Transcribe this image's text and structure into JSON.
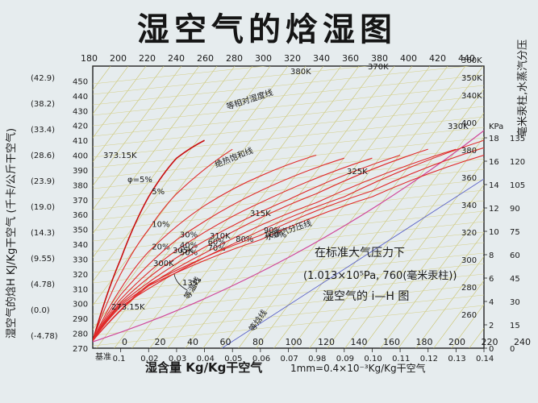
{
  "title": "湿空气的焓湿图",
  "axes": {
    "xlabel": "湿含量 Kg/Kg干空气",
    "scale_note": "1mm=0.4×10⁻³Kg/Kg干空气",
    "ylabel_left": "湿空气的焓H KJ/Kg干空气 (千卡/公斤干空气)",
    "ylabel_right": "毫米汞柱,水蒸汽分压",
    "kpa_unit": "KPa",
    "origin_label": "基准"
  },
  "annotations": {
    "phi_series_label": "φ=5%",
    "const_rh_label": "等相对湿度线",
    "adiabatic_label": "绝热饱和线",
    "isenthalpic_label": "等焓线",
    "partial_pressure_label": "水蒸汽分压线",
    "const_temp_label": "等温线",
    "angle_label": "135°",
    "notes": [
      "在标准大气压力下",
      "(1.013×10⁵Pa, 760(毫米汞柱))",
      "湿空气的 i—H 图"
    ]
  },
  "chart_data": {
    "type": "line",
    "title": "湿空气的焓湿图",
    "xlabel": "湿含量 Kg/Kg干空气",
    "ylabel": "湿空气的焓H KJ/Kg干空气",
    "xlim": [
      0,
      0.14
    ],
    "ylim": [
      270,
      460
    ],
    "x_ticks": [
      {
        "value": 0.01,
        "label": "0.1"
      },
      {
        "value": 0.02,
        "label": "0.02"
      },
      {
        "value": 0.03,
        "label": "0.03"
      },
      {
        "value": 0.04,
        "label": "0.04"
      },
      {
        "value": 0.05,
        "label": "0.05"
      },
      {
        "value": 0.06,
        "label": "0.06"
      },
      {
        "value": 0.07,
        "label": "0.07"
      },
      {
        "value": 0.08,
        "label": "0.98"
      },
      {
        "value": 0.09,
        "label": "0.09"
      },
      {
        "value": 0.1,
        "label": "0.10"
      },
      {
        "value": 0.11,
        "label": "0.11"
      },
      {
        "value": 0.12,
        "label": "0.12"
      },
      {
        "value": 0.13,
        "label": "0.13"
      },
      {
        "value": 0.14,
        "label": "0.14"
      }
    ],
    "inner_x_ticks": [
      "0",
      "20",
      "40",
      "60",
      "80",
      "100",
      "120",
      "140",
      "160",
      "180",
      "200",
      "220",
      "240"
    ],
    "left_ticks": [
      270,
      280,
      290,
      300,
      310,
      320,
      330,
      340,
      350,
      360,
      370,
      380,
      390,
      400,
      410,
      420,
      430,
      440,
      450
    ],
    "left_kcal_labels": [
      "(-4.78)",
      "(0.0)",
      "(4.78)",
      "(9.55)",
      "(14.3)",
      "(19.0)",
      "(23.9)",
      "(28.6)",
      "(33.4)",
      "(38.2)",
      "(42.9)"
    ],
    "top_ticks": [
      180,
      200,
      220,
      240,
      260,
      280,
      300,
      320,
      340,
      360,
      380,
      400,
      420,
      440
    ],
    "right_kpa_ticks": [
      0,
      2,
      4,
      6,
      8,
      10,
      12,
      14,
      16,
      18
    ],
    "right_mmhg_ticks": [
      0,
      15,
      30,
      45,
      60,
      75,
      90,
      105,
      120,
      135
    ],
    "right_inner_ticks": [
      260,
      280,
      300,
      320,
      340,
      360,
      380,
      400
    ],
    "isotherm_labels": [
      "360K",
      "350K",
      "340K",
      "330K",
      "325K",
      "315K",
      "310K",
      "300K",
      "305K",
      "273.15K",
      "373.15K",
      "380K",
      "370K"
    ],
    "series": [
      {
        "name": "5%",
        "values": [
          [
            0.0,
            275
          ],
          [
            0.01,
            330
          ],
          [
            0.02,
            372
          ],
          [
            0.03,
            398
          ],
          [
            0.04,
            410
          ]
        ]
      },
      {
        "name": "10%",
        "values": [
          [
            0.0,
            275
          ],
          [
            0.01,
            320
          ],
          [
            0.02,
            350
          ],
          [
            0.03,
            374
          ],
          [
            0.05,
            404
          ]
        ]
      },
      {
        "name": "20%",
        "values": [
          [
            0.0,
            275
          ],
          [
            0.01,
            310
          ],
          [
            0.02,
            335
          ],
          [
            0.04,
            366
          ],
          [
            0.06,
            386
          ],
          [
            0.08,
            400
          ]
        ]
      },
      {
        "name": "30%",
        "values": [
          [
            0.0,
            275
          ],
          [
            0.01,
            306
          ],
          [
            0.03,
            343
          ],
          [
            0.06,
            376
          ],
          [
            0.09,
            398
          ]
        ]
      },
      {
        "name": "40%",
        "values": [
          [
            0.0,
            275
          ],
          [
            0.01,
            303
          ],
          [
            0.03,
            336
          ],
          [
            0.06,
            368
          ],
          [
            0.1,
            398
          ]
        ]
      },
      {
        "name": "50%",
        "values": [
          [
            0.0,
            275
          ],
          [
            0.01,
            301
          ],
          [
            0.03,
            331
          ],
          [
            0.07,
            370
          ],
          [
            0.11,
            400
          ]
        ]
      },
      {
        "name": "60%",
        "values": [
          [
            0.0,
            275
          ],
          [
            0.01,
            300
          ],
          [
            0.04,
            338
          ],
          [
            0.08,
            374
          ],
          [
            0.12,
            404
          ]
        ]
      },
      {
        "name": "70%",
        "values": [
          [
            0.0,
            275
          ],
          [
            0.01,
            299
          ],
          [
            0.04,
            334
          ],
          [
            0.08,
            368
          ],
          [
            0.13,
            404
          ]
        ]
      },
      {
        "name": "80%",
        "values": [
          [
            0.0,
            275
          ],
          [
            0.01,
            298
          ],
          [
            0.05,
            340
          ],
          [
            0.09,
            372
          ],
          [
            0.14,
            410
          ]
        ]
      },
      {
        "name": "90%",
        "values": [
          [
            0.0,
            275
          ],
          [
            0.02,
            313
          ],
          [
            0.06,
            346
          ],
          [
            0.1,
            376
          ],
          [
            0.14,
            405
          ]
        ]
      },
      {
        "name": "100%",
        "values": [
          [
            0.0,
            275
          ],
          [
            0.02,
            312
          ],
          [
            0.06,
            343
          ],
          [
            0.1,
            372
          ],
          [
            0.14,
            400
          ]
        ]
      }
    ]
  }
}
